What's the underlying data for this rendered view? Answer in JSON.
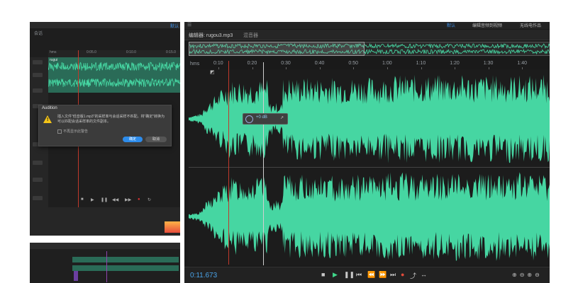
{
  "left_top": {
    "tab_label": "会话",
    "header_right": "默认",
    "ruler_ticks": [
      "hms",
      "0:05.0",
      "0:10.0",
      "0:15.0"
    ],
    "clip_label": "rugui",
    "track_count": 6
  },
  "dialog": {
    "title": "Audition",
    "message": "插入文件\"低音版1.mp3\"的采样率与会话采样不匹配。将\"确定\"转换为可以匹配会话采样率的文件副本。",
    "checkbox_label": "不再显示此警告",
    "ok_label": "确定",
    "cancel_label": "取消"
  },
  "main": {
    "workspace_tabs": [
      "默认",
      "编辑音频到视频",
      "无线电作品"
    ],
    "editor_tab": "编辑器: rugou3.mp3",
    "mixer_tab": "混音器",
    "time_unit": "hms",
    "ruler_ticks": [
      "0:10",
      "0:20",
      "0:30",
      "0:40",
      "0:50",
      "1:00",
      "1:10",
      "1:20",
      "1:30",
      "1:40"
    ],
    "hud_value": "+0 dB",
    "current_time": "0:11.673",
    "transport_buttons": [
      "stop-icon",
      "play-icon",
      "pause-icon",
      "go-to-start-icon",
      "rewind-icon",
      "fast-forward-icon",
      "go-to-end-icon",
      "record-icon",
      "loop-icon",
      "skip-selection-icon"
    ],
    "zoom_buttons": [
      "zoom-in-amplitude-icon",
      "zoom-out-amplitude-icon",
      "zoom-in-time-icon",
      "zoom-out-time-icon"
    ]
  },
  "colors": {
    "waveform": "#46d6a2",
    "playhead": "#c0392b",
    "accent": "#3d8ee6",
    "background": "#1c1c1c",
    "warning": "#f5c518"
  }
}
